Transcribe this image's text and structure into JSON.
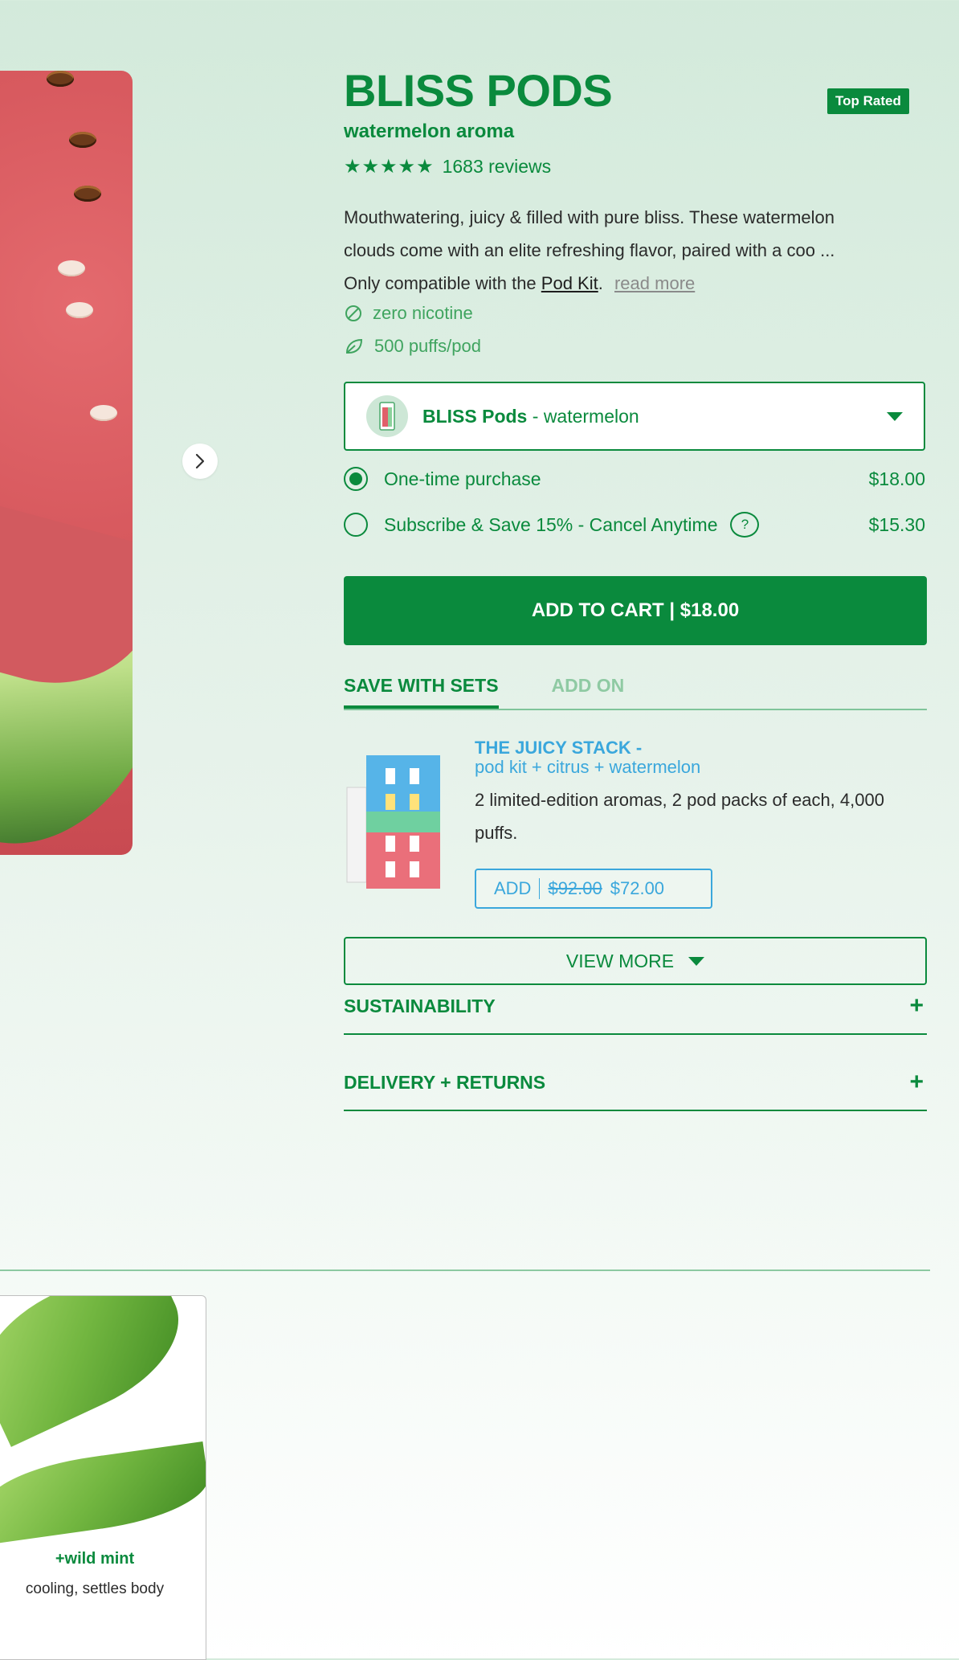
{
  "product": {
    "title": "BLISS PODS",
    "badge": "Top Rated",
    "aroma": "watermelon aroma",
    "stars": "★★★★★",
    "reviews": "1683 reviews",
    "description_line1": "Mouthwatering, juicy & filled with pure bliss. These watermelon",
    "description_line2": "clouds come with an elite refreshing flavor, paired with a coo ...",
    "description_line3_prefix": "Only compatible with the",
    "description_link": "Pod Kit",
    "description_suffix": ".",
    "read_more": "read more",
    "features": [
      {
        "icon": "no-nicotine-icon",
        "label": "zero nicotine"
      },
      {
        "icon": "leaf-icon",
        "label": "500 puffs/pod"
      }
    ]
  },
  "variant_select": {
    "name": "BLISS Pods",
    "sep": " - ",
    "value": "watermelon"
  },
  "purchase_options": [
    {
      "label": "One-time purchase",
      "price": "$18.00",
      "selected": true
    },
    {
      "label": "Subscribe & Save 15% - Cancel Anytime",
      "help": "?",
      "price": "$15.30",
      "selected": false
    }
  ],
  "cart": {
    "label": "ADD TO CART | $18.00"
  },
  "tabs": [
    {
      "label": "SAVE WITH SETS",
      "active": true
    },
    {
      "label": "ADD ON",
      "active": false
    }
  ],
  "set_item": {
    "title": "THE JUICY STACK -",
    "subtitle": "pod kit + citrus + watermelon",
    "description_line1": "2 limited-edition aromas, 2 pod packs of each, 4,000",
    "description_line2": "puffs.",
    "add_label": "ADD",
    "old_price": "$92.00",
    "price": "$72.00"
  },
  "view_more": "VIEW MORE",
  "accordions": [
    {
      "label": "SUSTAINABILITY",
      "icon": "+"
    },
    {
      "label": "DELIVERY + RETURNS",
      "icon": "+"
    }
  ],
  "addon_card": {
    "title": "+wild mint",
    "subtitle": "cooling, settles body"
  },
  "colors": {
    "brand_green": "#0a8a3d",
    "light_green": "#3fa45f",
    "set_blue": "#3aa7dc",
    "badge_bg": "#0a8a3d"
  }
}
